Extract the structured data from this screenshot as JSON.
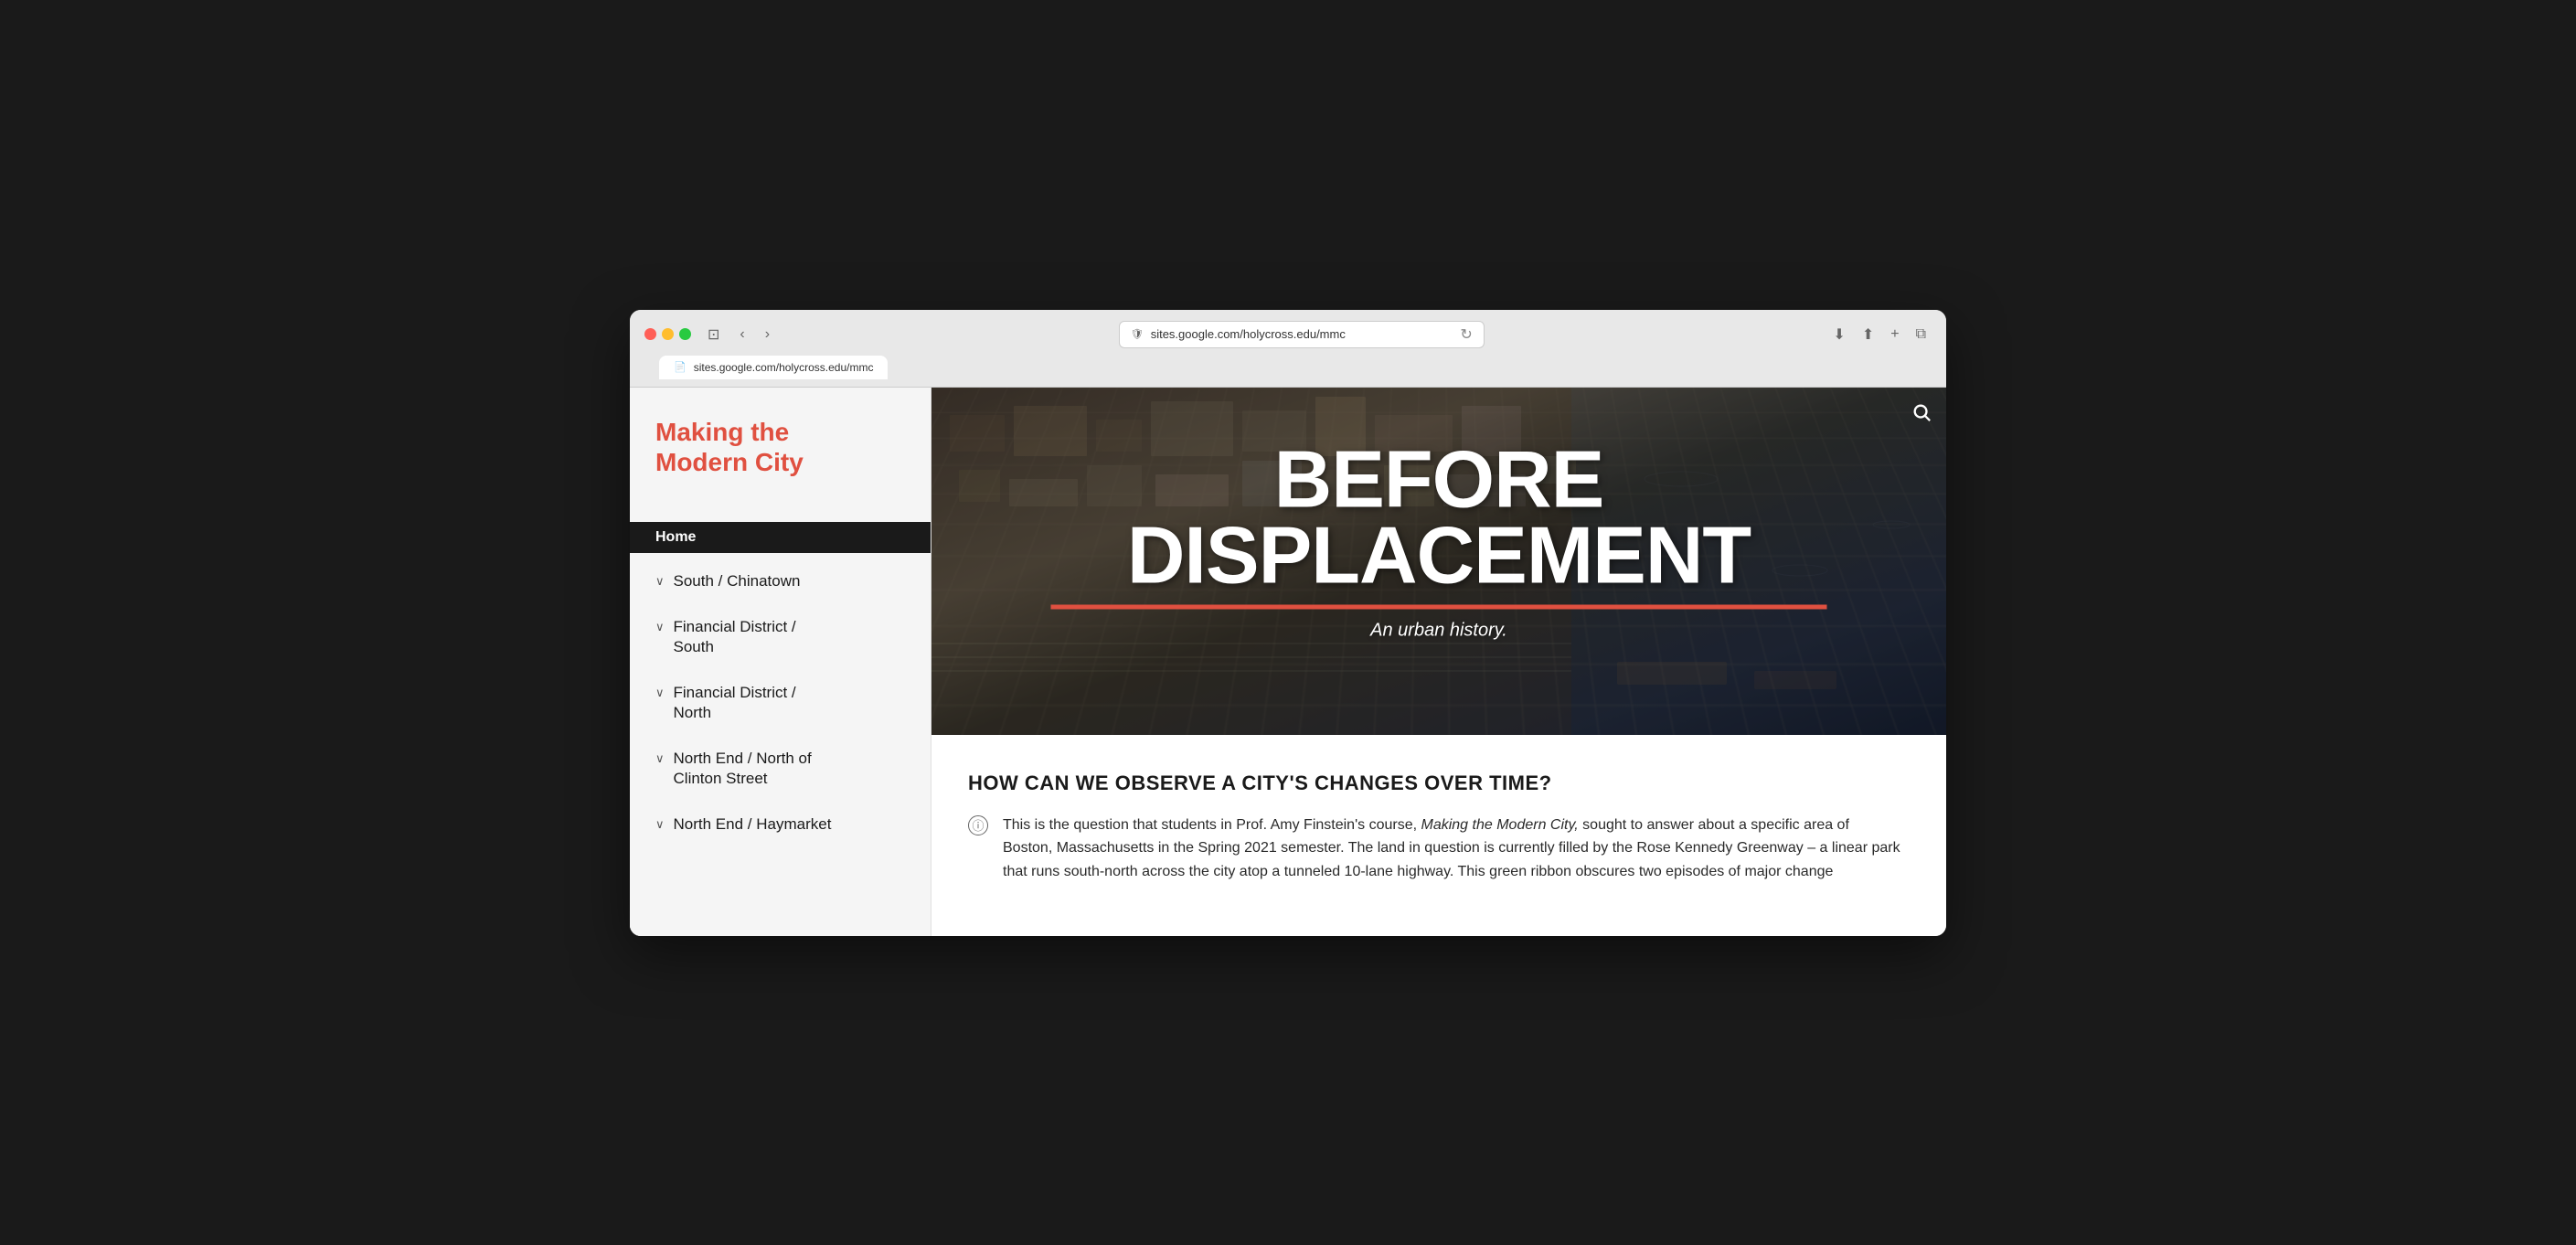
{
  "browser": {
    "url": "sites.google.com/holycross.edu/mmc",
    "tab_label": "sites.google.com/holycross.edu/mmc"
  },
  "sidebar": {
    "site_title": "Making the\nModern City",
    "nav_items": [
      {
        "id": "home",
        "label": "Home",
        "active": true,
        "chevron": false
      },
      {
        "id": "south-chinatown",
        "label": "South / Chinatown",
        "active": false,
        "chevron": true
      },
      {
        "id": "financial-district-south",
        "label": "Financial District / South",
        "active": false,
        "chevron": true
      },
      {
        "id": "financial-district-north",
        "label": "Financial District / North",
        "active": false,
        "chevron": true
      },
      {
        "id": "north-end-clinton",
        "label": "North End / North of Clinton Street",
        "active": false,
        "chevron": true
      },
      {
        "id": "north-end-haymarket",
        "label": "North End / Haymarket",
        "active": false,
        "chevron": true
      }
    ]
  },
  "hero": {
    "title": "BEFORE DISPLACEMENT",
    "subtitle": "An urban history.",
    "search_label": "search"
  },
  "article": {
    "heading": "HOW CAN WE OBSERVE A CITY'S CHANGES OVER TIME?",
    "body": "This is the question that students in Prof. Amy Finstein's course, Making the Modern City, sought to answer about a specific area of Boston, Massachusetts in the Spring 2021 semester. The land in question is currently filled by the Rose Kennedy Greenway – a linear park that runs south-north across the city atop a tunneled 10-lane highway. This green ribbon obscures two episodes of major change"
  },
  "colors": {
    "accent_red": "#e05040",
    "sidebar_bg": "#f5f5f5",
    "nav_active_bg": "#1a1a1a",
    "hero_divider": "#e05040"
  }
}
